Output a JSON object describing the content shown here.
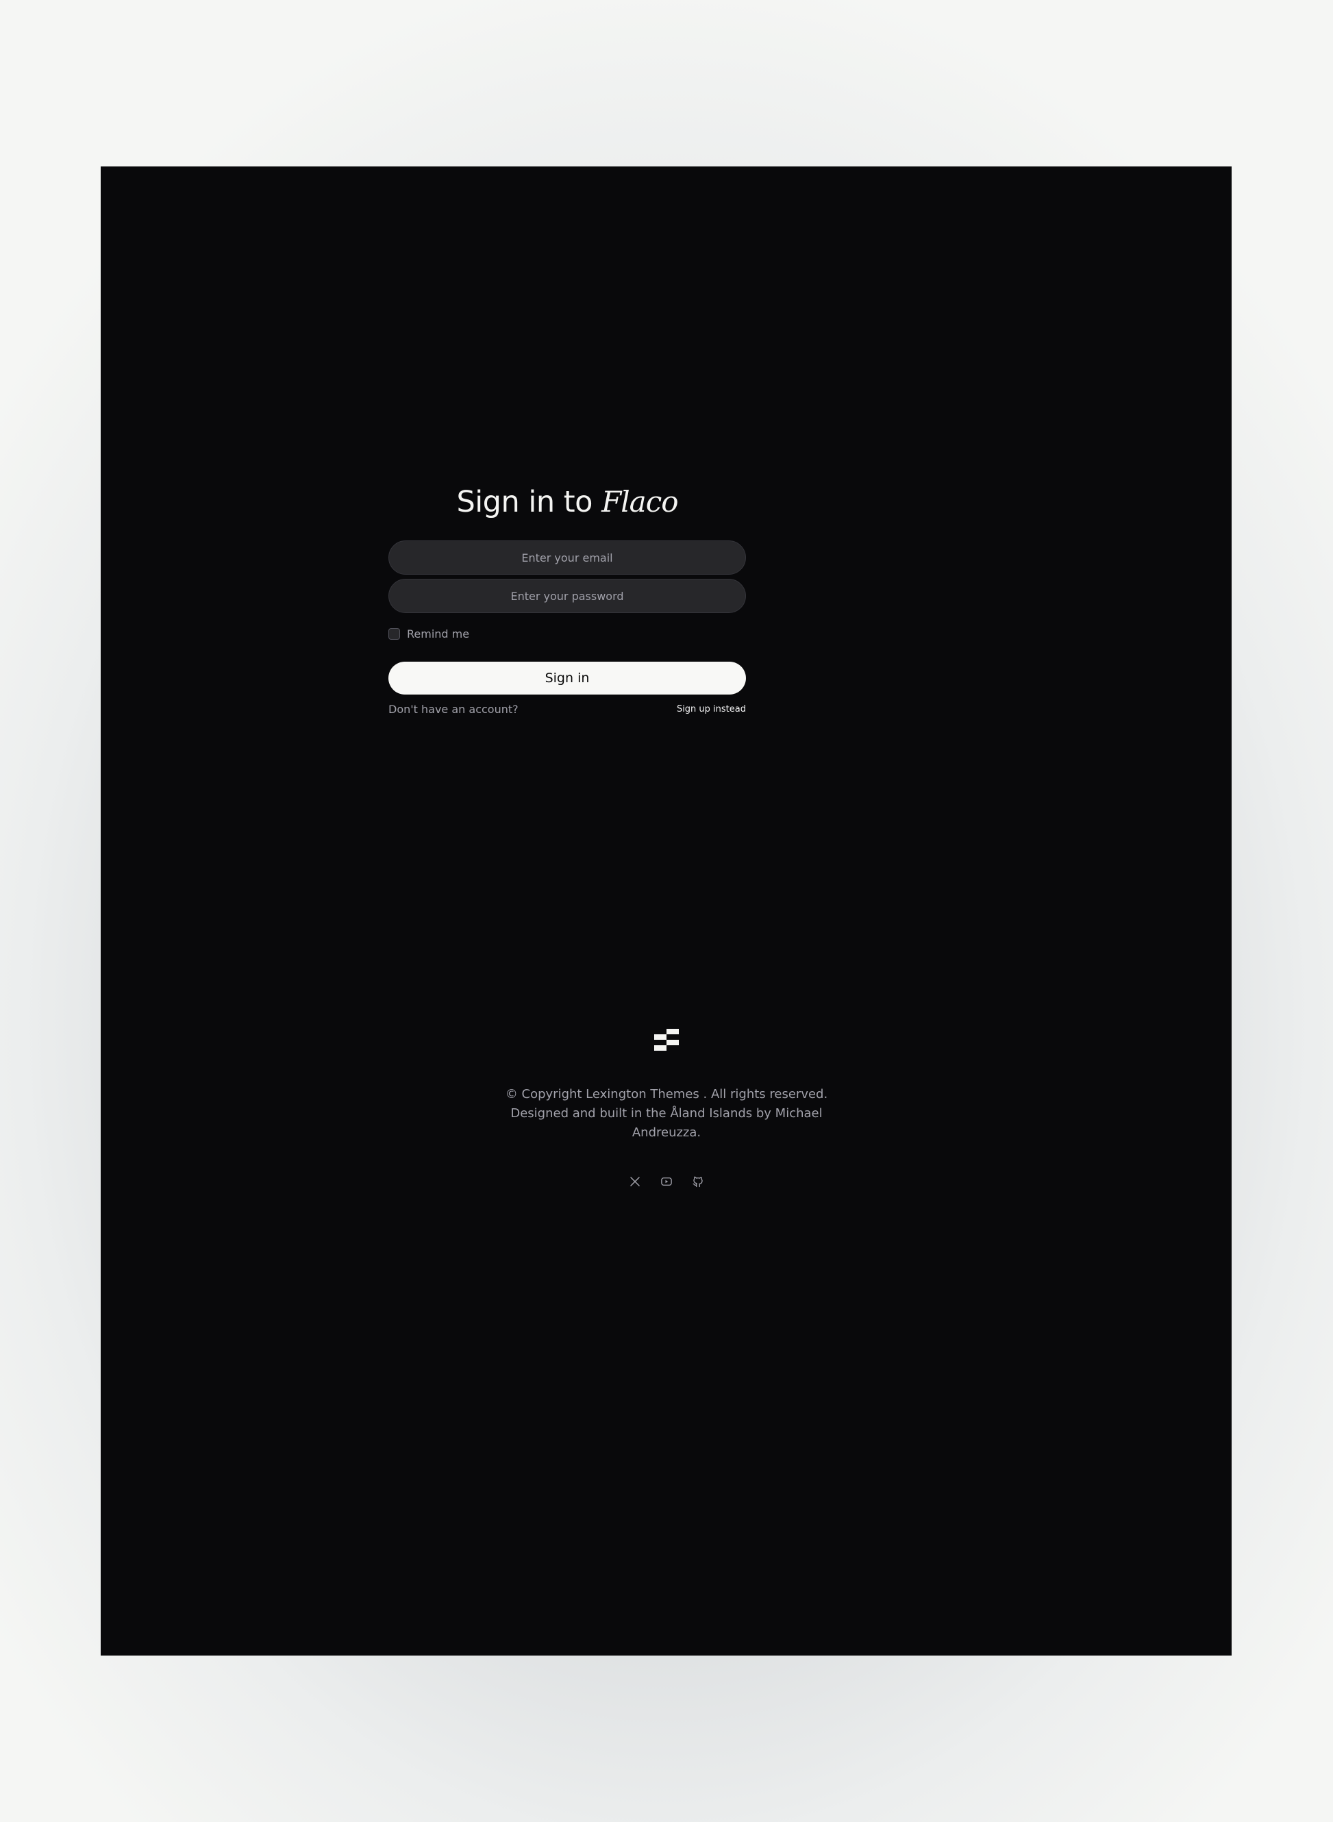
{
  "login": {
    "title_prefix": "Sign in to",
    "title_brand": "Flaco",
    "email_placeholder": "Enter your email",
    "password_placeholder": "Enter your password",
    "remember_label": "Remind me",
    "submit_label": "Sign in",
    "no_account_text": "Don't have an account?",
    "signup_link": "Sign up instead"
  },
  "footer": {
    "logo_icon": "stacked-bars-logo-icon",
    "copyright_text": "© Copyright Lexington Themes . All rights reserved. Designed and built in the Åland Islands by Michael Andreuzza.",
    "social_icons": [
      "x-icon",
      "youtube-icon",
      "github-icon"
    ]
  },
  "colors": {
    "frame_background": "#09090b",
    "input_background": "#27272a",
    "button_background": "#f8f8f6",
    "text_primary": "#f4f4f2",
    "text_muted": "#a1a1aa"
  }
}
